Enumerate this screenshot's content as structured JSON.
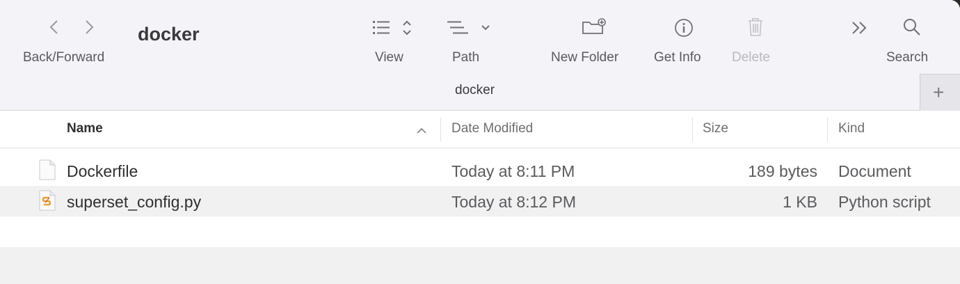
{
  "toolbar": {
    "back_forward_label": "Back/Forward",
    "title": "docker",
    "view_label": "View",
    "path_label": "Path",
    "new_folder_label": "New Folder",
    "get_info_label": "Get Info",
    "delete_label": "Delete",
    "search_label": "Search"
  },
  "pathbar": {
    "current": "docker"
  },
  "columns": {
    "name": "Name",
    "date_modified": "Date Modified",
    "size": "Size",
    "kind": "Kind"
  },
  "files": [
    {
      "name": "Dockerfile",
      "date_modified": "Today at 8:11 PM",
      "size": "189 bytes",
      "kind": "Document",
      "icon": "document-icon"
    },
    {
      "name": "superset_config.py",
      "date_modified": "Today at 8:12 PM",
      "size": "1 KB",
      "kind": "Python script",
      "icon": "python-file-icon"
    }
  ],
  "colors": {
    "toolbar_bg": "#f4f3f8",
    "alt_row_bg": "#f1f1f2",
    "python_icon_accent": "#e8a33a"
  }
}
